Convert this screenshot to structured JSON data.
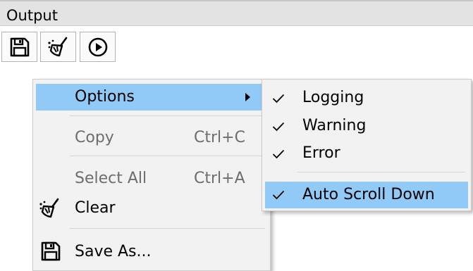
{
  "panel": {
    "title": "Output"
  },
  "toolbar": {
    "save_icon": "save-icon",
    "clear_icon": "broom-icon",
    "play_icon": "play-icon"
  },
  "context_menu": {
    "options_label": "Options",
    "copy_label": "Copy",
    "copy_shortcut": "Ctrl+C",
    "select_all_label": "Select All",
    "select_all_shortcut": "Ctrl+A",
    "clear_label": "Clear",
    "save_as_label": "Save As..."
  },
  "options_submenu": {
    "items": [
      {
        "label": "Logging",
        "checked": true
      },
      {
        "label": "Warning",
        "checked": true
      },
      {
        "label": "Error",
        "checked": true
      },
      {
        "label": "Auto Scroll Down",
        "checked": true
      }
    ]
  },
  "colors": {
    "highlight": "#91c9f7",
    "menu_background": "#f2f2f2",
    "title_background": "#e3e3e3",
    "disabled_text": "#6d6d6d"
  }
}
